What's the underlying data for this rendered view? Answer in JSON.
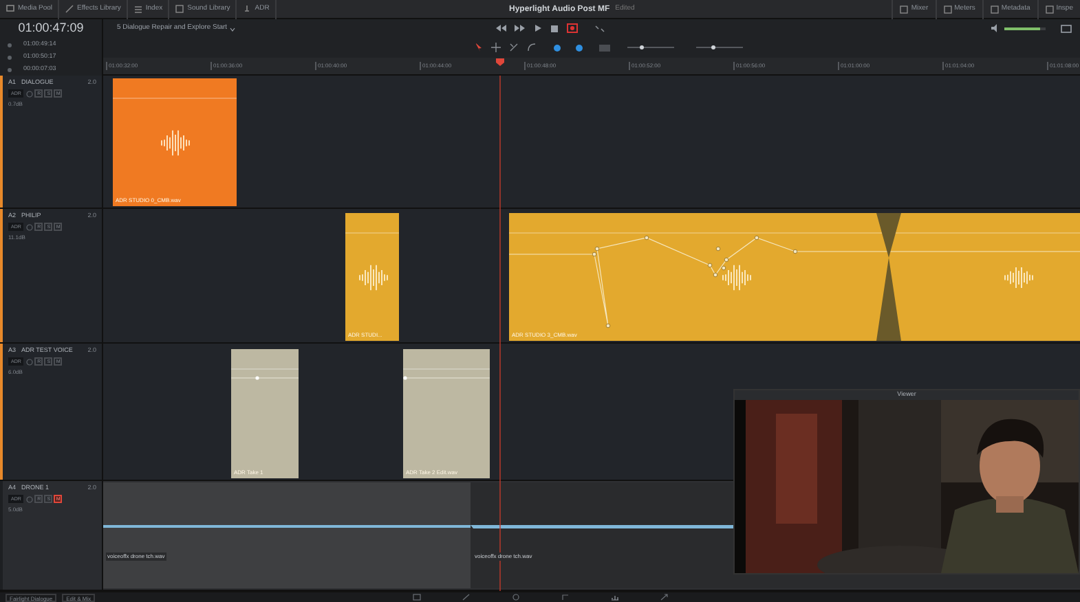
{
  "menu": {
    "items": [
      "Media Pool",
      "Effects Library",
      "Index",
      "Sound Library",
      "ADR"
    ],
    "title": "Hyperlight Audio Post MF",
    "status": "Edited",
    "right_items": [
      "Mixer",
      "Meters",
      "Metadata",
      "Inspe"
    ]
  },
  "transport": {
    "volume": {
      "level": 0.87
    },
    "zoom_sliders": [
      {
        "level": 0.3
      },
      {
        "level": 0.35
      }
    ]
  },
  "timecode": "01:00:47:09",
  "timecodes": [
    "01:00:49:14",
    "01:00:50:17",
    "00:00:07:03"
  ],
  "timeline_name": "5 Dialogue Repair and Explore Start",
  "ruler": [
    "01:00:32:00",
    "01:00:36:00",
    "01:00:40:00",
    "01:00:44:00",
    "01:00:48:00",
    "01:00:52:00",
    "01:00:56:00",
    "01:01:00:00",
    "01:01:04:00",
    "01:01:08:00"
  ],
  "tracks": [
    {
      "id": "A1",
      "name": "DIALOGUE",
      "format": "2.0",
      "input": "ADR",
      "buttons": [
        "R",
        "S",
        "M"
      ],
      "muted": false,
      "selected": true,
      "level_text": "0.7dB",
      "clips": [
        {
          "label": "ADR STUDIO 0_CMB.wav",
          "color": "#f07a22"
        }
      ]
    },
    {
      "id": "A2",
      "name": "PHILIP",
      "format": "2.0",
      "input": "ADR",
      "buttons": [
        "R",
        "S",
        "M"
      ],
      "muted": false,
      "selected": true,
      "level_text": "11.1dB",
      "clips": [
        {
          "label": "ADR STUDI...",
          "color": "#e3a92e"
        },
        {
          "label": "ADR STUDIO 3_CMB.wav",
          "color": "#e3a92e"
        }
      ]
    },
    {
      "id": "A3",
      "name": "ADR TEST VOICE",
      "format": "2.0",
      "input": "ADR",
      "buttons": [
        "R",
        "S",
        "M"
      ],
      "muted": false,
      "selected": true,
      "level_text": "6.0dB",
      "clips": [
        {
          "label": "ADR Take 1",
          "color": "#bdb8a2"
        },
        {
          "label": "ADR Take 2 Edit.wav",
          "color": "#bdb8a2"
        }
      ]
    },
    {
      "id": "A4",
      "name": "DRONE 1",
      "format": "2.0",
      "input": "ADR",
      "buttons": [
        "R",
        "S",
        "M"
      ],
      "muted": true,
      "selected": false,
      "level_text": "5.0dB",
      "clips": [
        {
          "label": "voiceoffx drone tch.wav",
          "color": "#3e3f41"
        },
        {
          "label": "voiceoffx drone tch.wav",
          "color": "#2a2b2d"
        }
      ]
    }
  ],
  "viewer": {
    "title": "Viewer"
  },
  "bottom": {
    "items": [
      "Fairlight Dialogue",
      "Edit & Mix"
    ]
  }
}
